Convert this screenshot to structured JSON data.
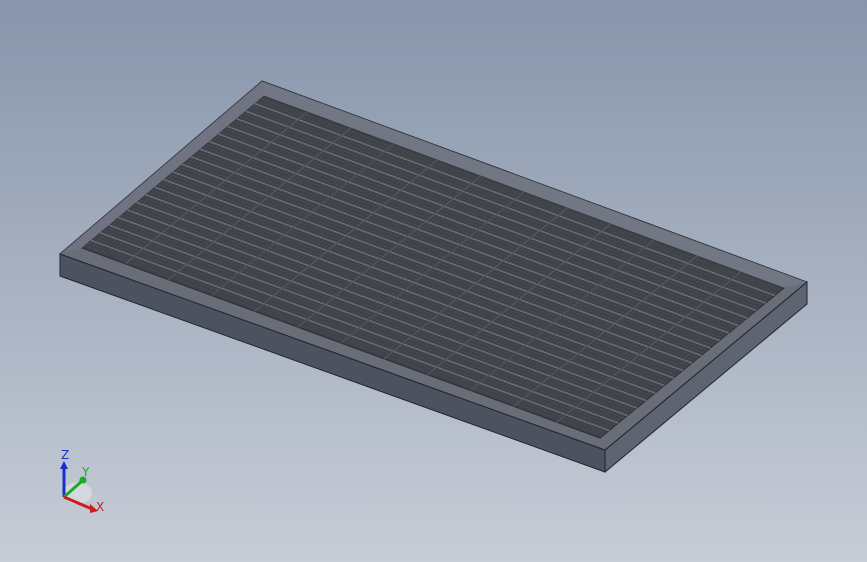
{
  "viewport": {
    "background_top": "#8795ab",
    "background_bottom": "#c7cdd7",
    "model": "solar-panel-part"
  },
  "triad": {
    "x_label": "X",
    "y_label": "Y",
    "z_label": "Z",
    "x_color": "#c81e1e",
    "y_color": "#1fa82a",
    "z_color": "#1a2fd0"
  }
}
